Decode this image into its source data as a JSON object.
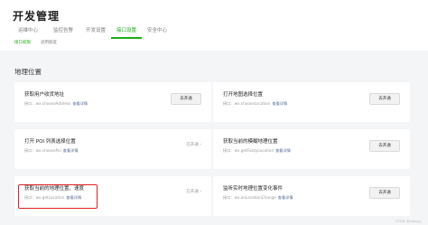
{
  "header": {
    "title": "开发管理",
    "tabs": [
      {
        "label": "运维中心"
      },
      {
        "label": "监控告警"
      },
      {
        "label": "开发设置"
      },
      {
        "label": "接口设置"
      },
      {
        "label": "安全中心"
      }
    ],
    "active_tab_index": 3,
    "subtabs": [
      {
        "label": "接口权限"
      },
      {
        "label": "调用额度"
      }
    ],
    "active_subtab_index": 0
  },
  "section": {
    "title": "地理位置"
  },
  "cards": [
    {
      "name": "获取用户收货地址",
      "api_label": "接口：",
      "api": "wx.chooseAddress",
      "detail_link": "查看详情",
      "action": "去开通",
      "state": "button"
    },
    {
      "name": "打开地图选择位置",
      "api_label": "接口：",
      "api": "wx.chooseLocation",
      "detail_link": "查看详情",
      "action": "去开通",
      "state": "button"
    },
    {
      "name": "打开 POI 列表选择位置",
      "api_label": "接口：",
      "api": "wx.choosePoi",
      "detail_link": "查看详情",
      "action": "已开通 ›",
      "state": "status"
    },
    {
      "name": "获取当前的模糊地理位置",
      "api_label": "接口：",
      "api": "wx.getFuzzyLocation",
      "detail_link": "查看详情",
      "action": "去开通",
      "state": "button"
    },
    {
      "name": "获取当前的地理位置、速度",
      "api_label": "接口：",
      "api": "wx.getLocation",
      "detail_link": "查看详情",
      "action": "已开通 ›",
      "state": "status"
    },
    {
      "name": "监听实时地理位置变化事件",
      "api_label": "接口：",
      "api": "wx.onLocationChange",
      "detail_link": "查看详情",
      "action": "去开通",
      "state": "button"
    }
  ],
  "watermark": "CSDN @xiaogy_",
  "colors": {
    "accent": "#1aad19",
    "link": "#576b95",
    "highlight": "#e02020",
    "background": "#f4f5f7"
  }
}
